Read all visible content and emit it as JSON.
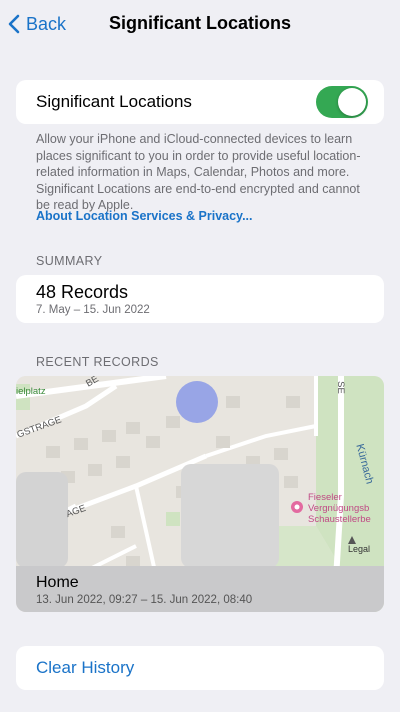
{
  "nav": {
    "back_label": "Back",
    "title": "Significant Locations"
  },
  "toggle": {
    "label": "Significant Locations",
    "state": "on",
    "accent": "#34a853"
  },
  "description": {
    "text": "Allow your iPhone and iCloud-connected devices to learn places significant to you in order to provide useful location-related information in Maps, Calendar, Photos and more. Significant Locations are end-to-end encrypted and cannot be read by Apple.",
    "link": "About Location Services & Privacy..."
  },
  "summary": {
    "header": "SUMMARY",
    "title": "48 Records",
    "date_range": "7. May – 15. Jun 2022"
  },
  "recent": {
    "header": "RECENT RECORDS",
    "map_labels": {
      "spielplatz": "ielplatz",
      "strasse_top": "GSTRAGE",
      "be": "BE",
      "se": "SE",
      "kurnach": "Kürnach",
      "strasse_left": "AGE",
      "poi_1": "Fieseler",
      "poi_2": "Vergnügungsb",
      "poi_3": "Schaustellerbe",
      "legal": "Legal"
    },
    "item": {
      "title": "Home",
      "time_range": "13. Jun 2022, 09:27 – 15. Jun 2022, 08:40"
    }
  },
  "actions": {
    "clear_history": "Clear History"
  },
  "colors": {
    "background": "#efeff4",
    "link": "#1a73c8",
    "secondary_text": "#6d6d72"
  }
}
